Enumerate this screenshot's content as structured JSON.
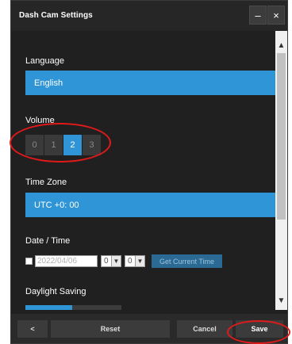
{
  "window": {
    "title": "Dash Cam Settings",
    "minimize_label": "–",
    "close_label": "×"
  },
  "language": {
    "label": "Language",
    "value": "English"
  },
  "volume": {
    "label": "Volume",
    "options": [
      "0",
      "1",
      "2",
      "3"
    ],
    "selected": "2"
  },
  "timezone": {
    "label": "Time Zone",
    "value": "UTC +0: 00"
  },
  "datetime": {
    "label": "Date / Time",
    "date_value": "2022/04/06",
    "hour_value": "0",
    "minute_value": "0",
    "get_time_label": "Get Current Time",
    "checked": false
  },
  "daylight_saving": {
    "label": "Daylight Saving",
    "enabled": true
  },
  "footer": {
    "back_label": "<",
    "reset_label": "Reset",
    "cancel_label": "Cancel",
    "save_label": "Save"
  },
  "colors": {
    "accent": "#2f95d6",
    "annotation": "#e01a1a",
    "background": "#202020"
  }
}
